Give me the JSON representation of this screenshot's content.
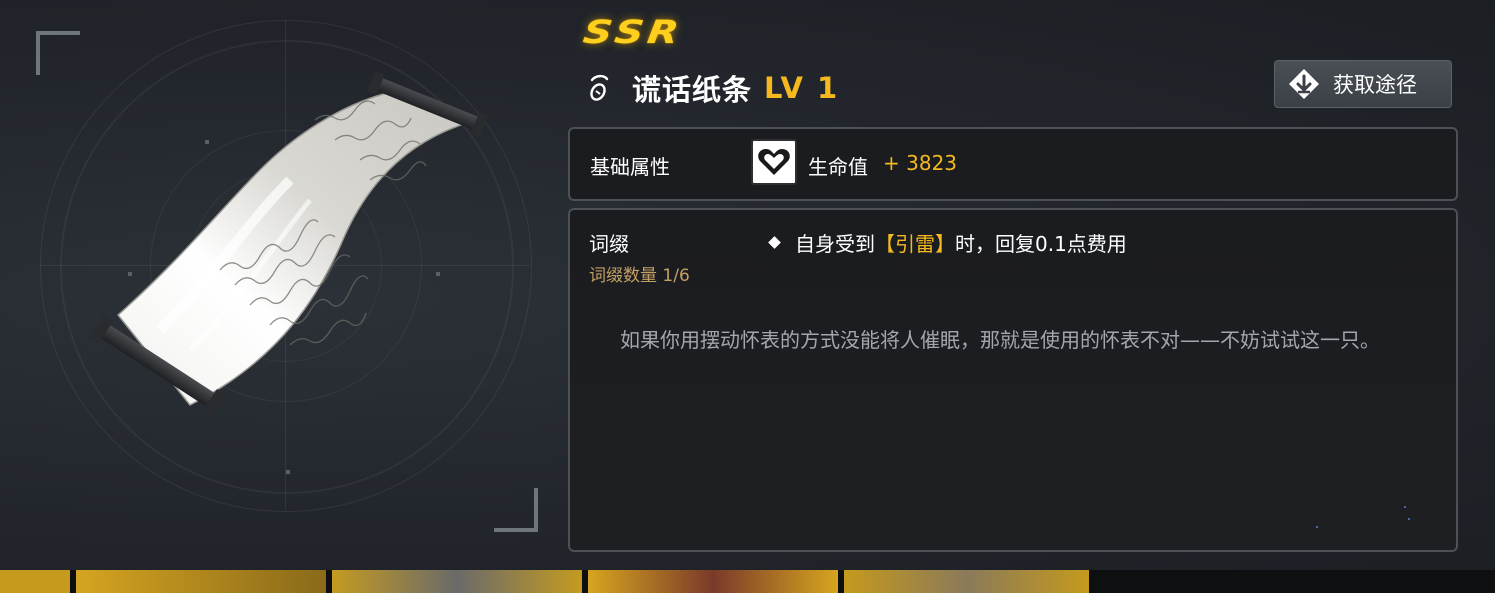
{
  "item": {
    "rarity": "SSR",
    "name": "谎话纸条",
    "level": "LV 1",
    "type_icon": "charm-icon"
  },
  "acquire_button": {
    "label": "获取途径",
    "icon": "acquire-arrow-icon"
  },
  "base_stats": {
    "label": "基础属性",
    "stat_icon": "heart-icon",
    "stat_name": "生命值",
    "stat_value": "+ 3823"
  },
  "affix": {
    "label": "词缀",
    "count": "词缀数量 1/6",
    "effect_prefix": "自身受到",
    "effect_keyword": "【引雷】",
    "effect_suffix": "时，回复0.1点费用",
    "flavor_text": "如果你用摆动怀表的方式没能将人催眠，那就是使用的怀表不对——不妨试试这一只。"
  },
  "colors": {
    "rarity_gold": "#ffcf1e",
    "highlight_gold": "#f5b91f",
    "count_tan": "#c3a064",
    "flavor_gray": "#a3a6ab"
  }
}
